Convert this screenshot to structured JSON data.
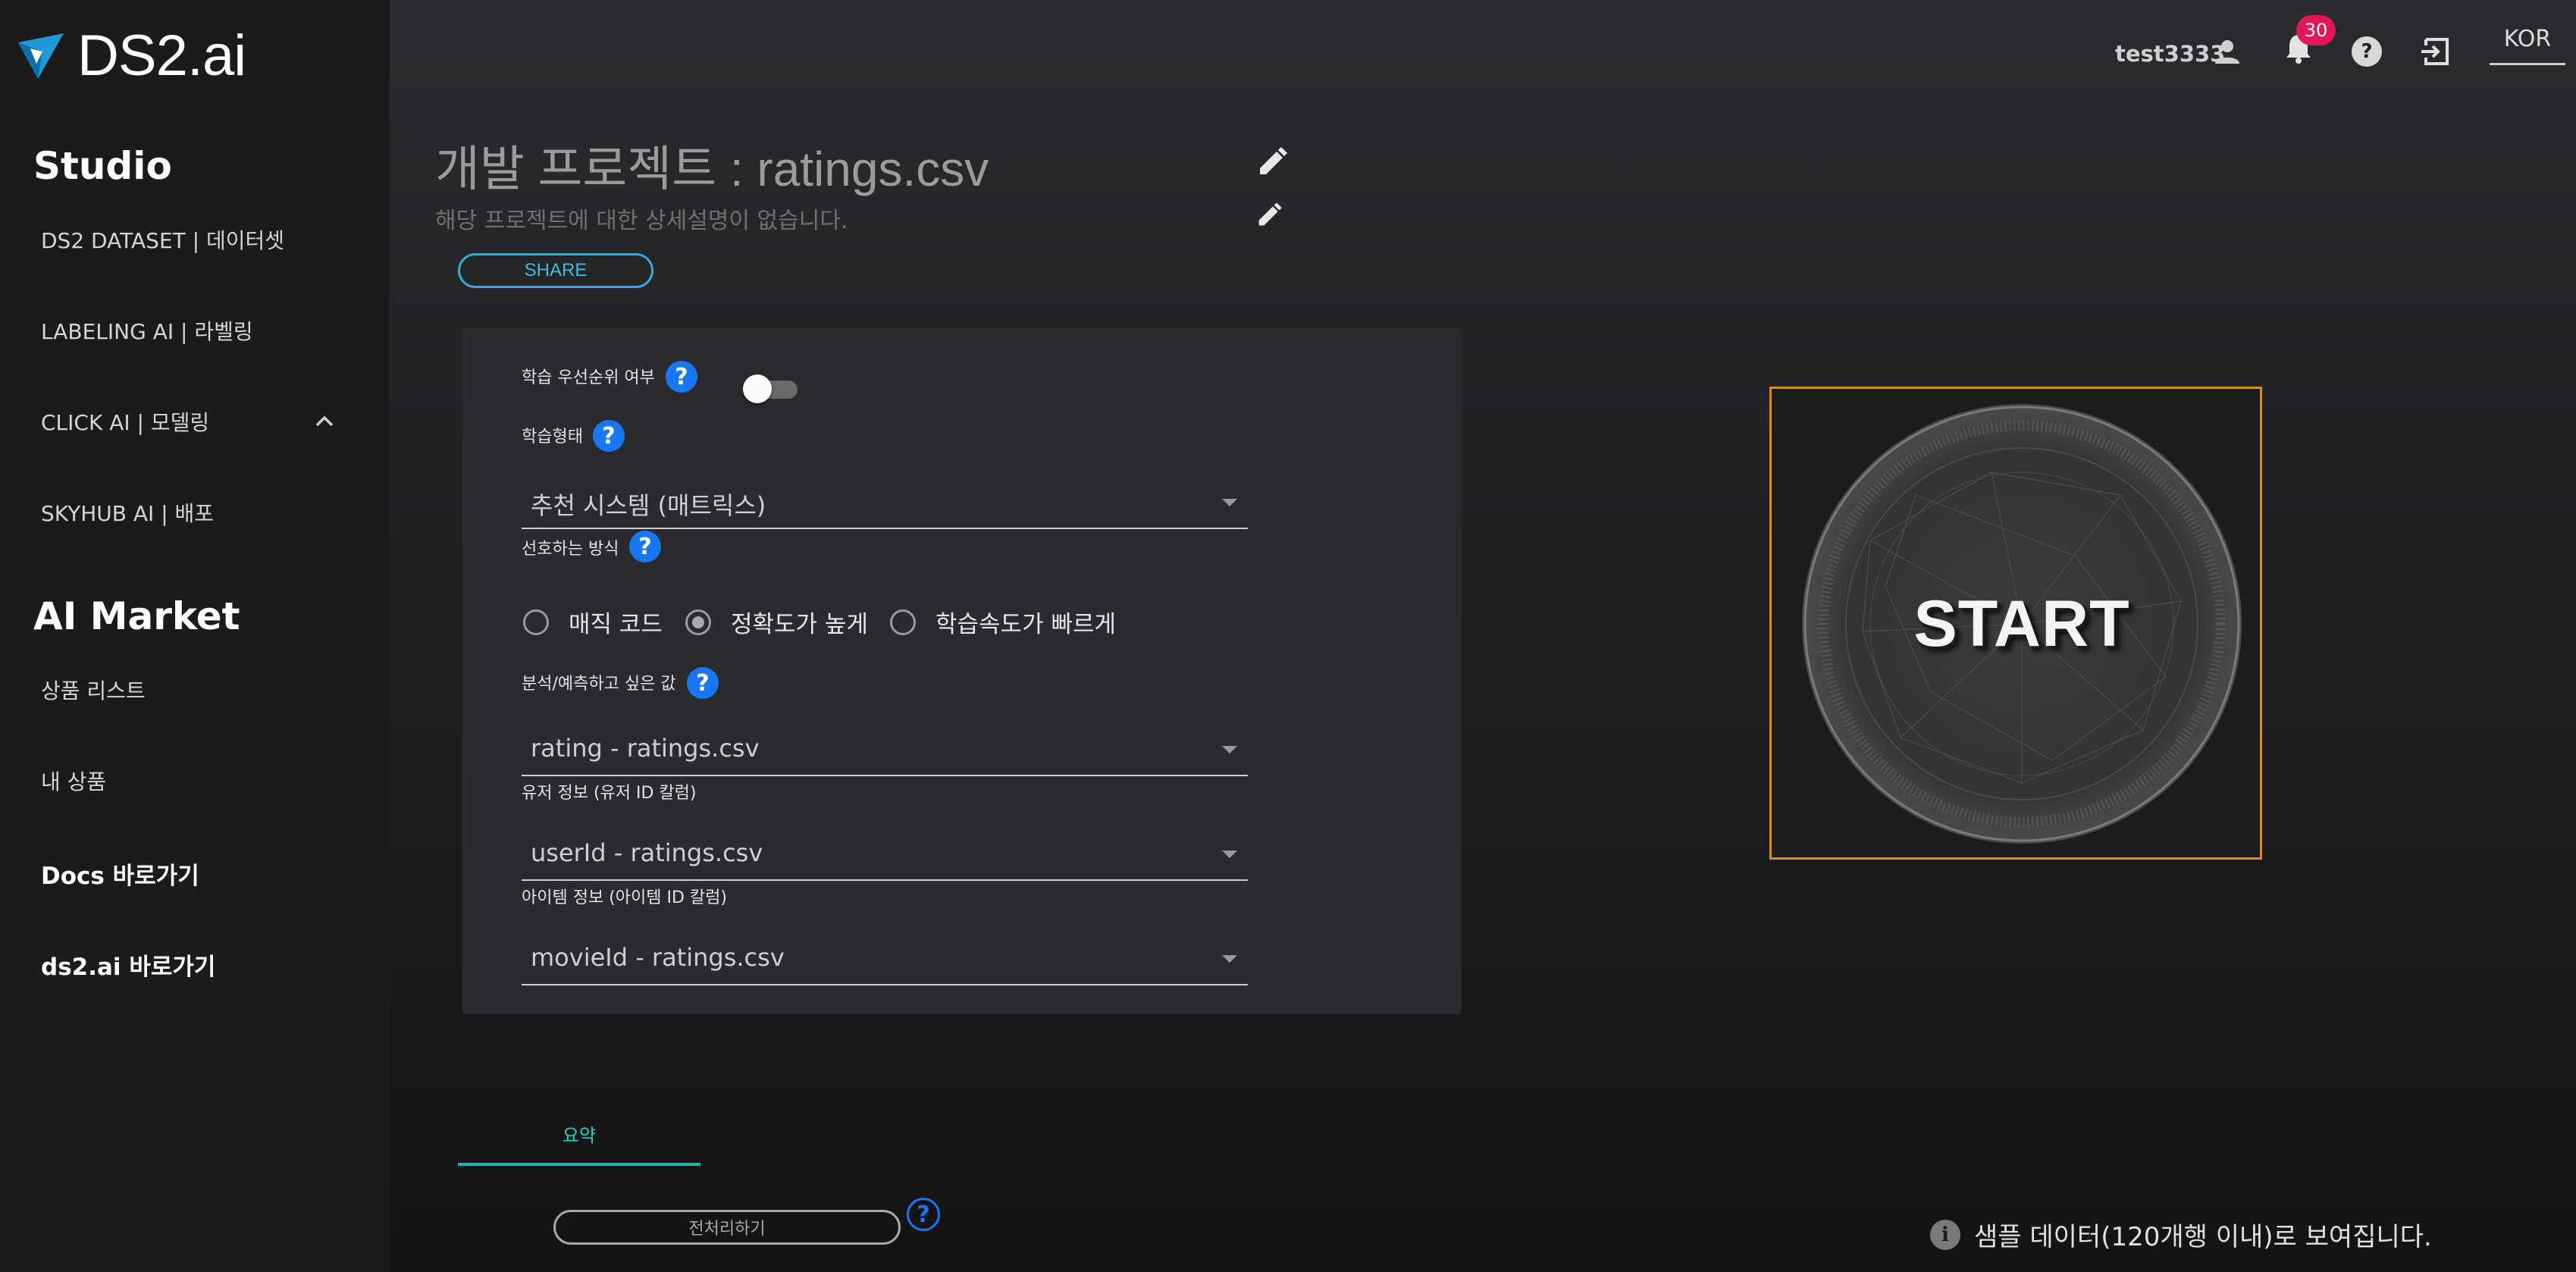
{
  "brand": {
    "name": "DS2.ai",
    "logo_color": "#1e9bd7"
  },
  "sidebar": {
    "studio_title": "Studio",
    "studio_items": [
      {
        "label": "DS2 DATASET | 데이터셋"
      },
      {
        "label": "LABELING AI | 라벨링"
      },
      {
        "label": "CLICK AI | 모델링",
        "expanded": true
      },
      {
        "label": "SKYHUB AI | 배포"
      }
    ],
    "market_title": "AI Market",
    "market_items": [
      {
        "label": "상품 리스트"
      },
      {
        "label": "내 상품"
      }
    ],
    "links": [
      {
        "label": "Docs 바로가기"
      },
      {
        "label": "ds2.ai 바로가기"
      }
    ]
  },
  "topbar": {
    "username": "test3333",
    "notification_count": "30",
    "language": "KOR",
    "icons": [
      "person-icon",
      "bell-icon",
      "help-icon",
      "logout-icon"
    ]
  },
  "project": {
    "title": "개발 프로젝트 : ratings.csv",
    "description": "해당 프로젝트에 대한 상세설명이 없습니다.",
    "share_label": "SHARE"
  },
  "form": {
    "priority_label": "학습 우선순위 여부",
    "priority_enabled": false,
    "train_type_label": "학습형태",
    "train_type_value": "추천 시스템 (매트릭스)",
    "method_label": "선호하는 방식",
    "method_options": [
      {
        "label": "매직 코드",
        "selected": false
      },
      {
        "label": "정확도가 높게",
        "selected": true
      },
      {
        "label": "학습속도가 빠르게",
        "selected": false
      }
    ],
    "target_label": "분석/예측하고 싶은 값",
    "target_value": "rating - ratings.csv",
    "user_label": "유저 정보 (유저 ID 칼럼)",
    "user_value": "userId - ratings.csv",
    "item_label": "아이템 정보 (아이템 ID 칼럼)",
    "item_value": "movieId - ratings.csv",
    "help_glyph": "?"
  },
  "start": {
    "label": "START",
    "accent": "#e08a1e"
  },
  "bottom": {
    "tab_label": "요약",
    "tab_accent": "#1bb6a8",
    "preprocess_label": "전처리하기",
    "sample_note": "샘플 데이터(120개행 이내)로 보여집니다."
  },
  "colors": {
    "help_blue": "#1877f2",
    "share_blue": "#36a9d6",
    "badge_red": "#e0185a"
  }
}
